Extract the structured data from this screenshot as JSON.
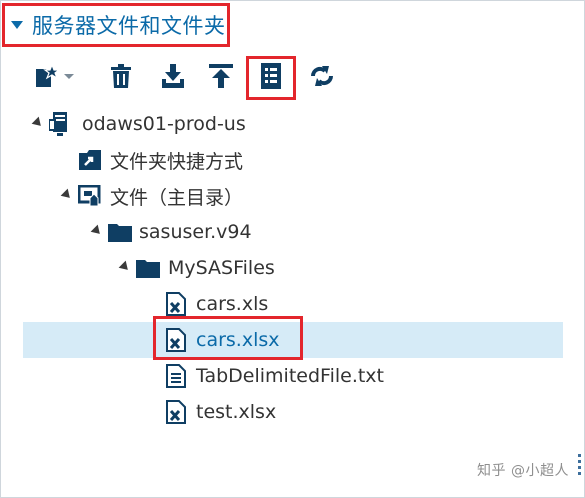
{
  "panel": {
    "title": "服务器文件和文件夹"
  },
  "toolbar": {
    "items": [
      {
        "name": "new-item-button",
        "icon": "new-item-icon"
      },
      {
        "name": "delete-button",
        "icon": "trash-icon"
      },
      {
        "name": "download-button",
        "icon": "download-icon"
      },
      {
        "name": "upload-button",
        "icon": "upload-icon"
      },
      {
        "name": "properties-button",
        "icon": "properties-icon"
      },
      {
        "name": "refresh-button",
        "icon": "refresh-icon"
      }
    ]
  },
  "tree": {
    "server": "odaws01-prod-us",
    "shortcuts": "文件夹快捷方式",
    "home": "文件（主目录）",
    "sasuser": "sasuser.v94",
    "mysasfiles": "MySASFiles",
    "files": [
      "cars.xls",
      "cars.xlsx",
      "TabDelimitedFile.txt",
      "test.xlsx"
    ],
    "selected_file": "cars.xlsx"
  },
  "watermark": "知乎 @小超人",
  "colors": {
    "accent": "#0b6aa8",
    "icon": "#0f3e63",
    "highlight": "#e3262c",
    "selection": "#d6ebf7"
  }
}
